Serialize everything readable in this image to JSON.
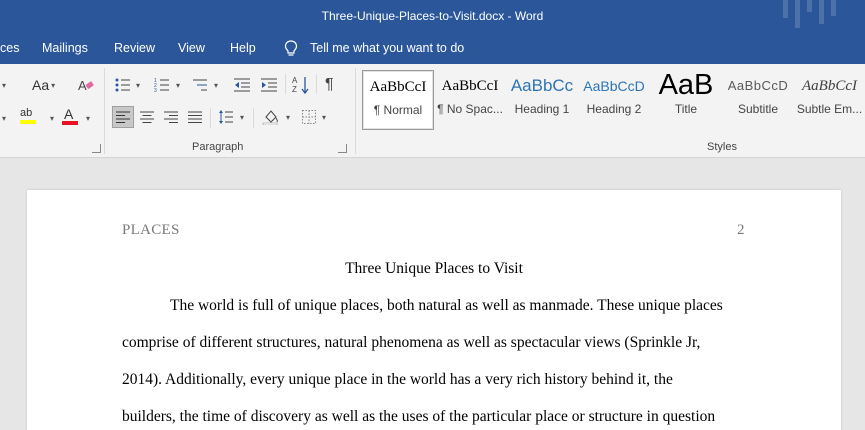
{
  "window": {
    "title": "Three-Unique-Places-to-Visit.docx  -  Word"
  },
  "tabs": [
    {
      "label": "ces"
    },
    {
      "label": "Mailings"
    },
    {
      "label": "Review"
    },
    {
      "label": "View"
    },
    {
      "label": "Help"
    },
    {
      "label": "Tell me what you want to do"
    }
  ],
  "ribbon": {
    "font": {
      "change_case_label": "Aa",
      "highlight_label": "ab",
      "font_color_label": "A"
    },
    "paragraph": {
      "group_label": "Paragraph",
      "show_marks_glyph": "¶"
    },
    "styles": {
      "group_label": "Styles",
      "items": [
        {
          "sample": "AaBbCcI",
          "label": "¶ Normal"
        },
        {
          "sample": "AaBbCcI",
          "label": "¶ No Spac..."
        },
        {
          "sample": "AaBbCc",
          "label": "Heading 1"
        },
        {
          "sample": "AaBbCcD",
          "label": "Heading 2"
        },
        {
          "sample": "AaB",
          "label": "Title"
        },
        {
          "sample": "AaBbCcD",
          "label": "Subtitle"
        },
        {
          "sample": "AaBbCcI",
          "label": "Subtle Em..."
        }
      ]
    }
  },
  "document": {
    "header_left": "PLACES",
    "page_number": "2",
    "title": "Three Unique Places to Visit",
    "lines": [
      "The world is full of unique places, both natural as well as manmade. These unique places",
      "comprise of different structures, natural phenomena as well as spectacular views (Sprinkle Jr,",
      "2014). Additionally, every unique place in the world has a very rich history behind it, the",
      "builders, the time of discovery as well as the uses of the particular place or structure in question"
    ]
  },
  "colors": {
    "accent": "#2b579a",
    "heading_blue": "#2e74b5",
    "highlight": "#ffff00",
    "font_red": "#e81123"
  }
}
